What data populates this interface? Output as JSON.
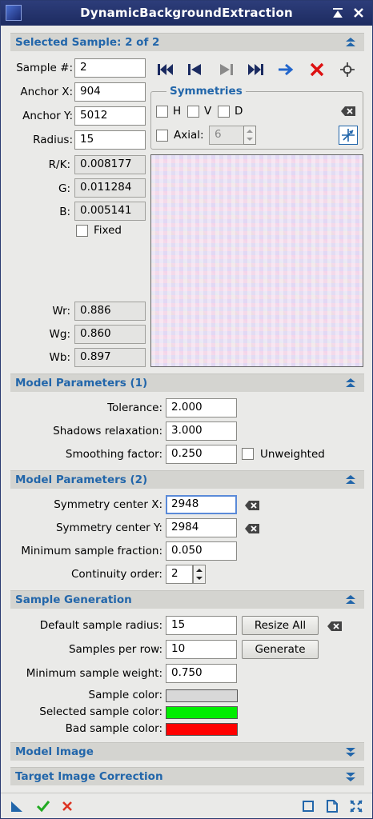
{
  "window": {
    "title": "DynamicBackgroundExtraction"
  },
  "selected_sample": {
    "header": "Selected Sample: 2 of 2",
    "sample_label": "Sample #:",
    "sample_value": "2",
    "anchor_x_label": "Anchor X:",
    "anchor_x_value": "904",
    "anchor_y_label": "Anchor Y:",
    "anchor_y_value": "5012",
    "radius_label": "Radius:",
    "radius_value": "15",
    "rk_label": "R/K:",
    "rk_value": "0.008177",
    "g_label": "G:",
    "g_value": "0.011284",
    "b_label": "B:",
    "b_value": "0.005141",
    "fixed_label": "Fixed",
    "wr_label": "Wr:",
    "wr_value": "0.886",
    "wg_label": "Wg:",
    "wg_value": "0.860",
    "wb_label": "Wb:",
    "wb_value": "0.897",
    "symmetries": {
      "title": "Symmetries",
      "h_label": "H",
      "v_label": "V",
      "d_label": "D",
      "axial_label": "Axial:",
      "axial_value": "6"
    }
  },
  "model_params_1": {
    "header": "Model Parameters (1)",
    "tolerance_label": "Tolerance:",
    "tolerance_value": "2.000",
    "shadows_label": "Shadows relaxation:",
    "shadows_value": "3.000",
    "smoothing_label": "Smoothing factor:",
    "smoothing_value": "0.250",
    "unweighted_label": "Unweighted"
  },
  "model_params_2": {
    "header": "Model Parameters (2)",
    "symx_label": "Symmetry center X:",
    "symx_value": "2948",
    "symy_label": "Symmetry center Y:",
    "symy_value": "2984",
    "minfrac_label": "Minimum sample fraction:",
    "minfrac_value": "0.050",
    "continuity_label": "Continuity order:",
    "continuity_value": "2"
  },
  "sample_generation": {
    "header": "Sample Generation",
    "radius_label": "Default sample radius:",
    "radius_value": "15",
    "resize_all": "Resize All",
    "per_row_label": "Samples per row:",
    "per_row_value": "10",
    "generate": "Generate",
    "min_weight_label": "Minimum sample weight:",
    "min_weight_value": "0.750",
    "sample_color_label": "Sample color:",
    "selected_color_label": "Selected sample color:",
    "bad_color_label": "Bad sample color:"
  },
  "collapsed_sections": {
    "model_image": "Model Image",
    "target_correction": "Target Image Correction"
  },
  "colors": {
    "accent": "#2266aa",
    "sample_color": "#d8d8d8",
    "selected_sample_color": "#00ee00",
    "bad_sample_color": "#ff0000"
  }
}
